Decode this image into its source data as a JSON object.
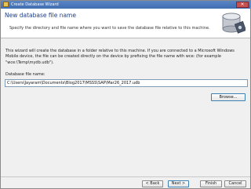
{
  "window": {
    "title": "Create Database Wizard",
    "close_label": "×"
  },
  "header": {
    "title": "New database file name",
    "subtitle": "Specify the directory and file name where you want to save the database file relative to this machine."
  },
  "body": {
    "description": "This wizard will create the database in a folder relative to this machine. If you are connected to a Microsoft Windows Mobile device, the file can be created directly on the device by prefixing the file name with wce: (for example \"wce:\\Temp\\mydb.udb\").",
    "field_label": "Database file name:",
    "field_value": "C:\\Users\\Jayaram\\Documents\\Blog2017\\MSSS\\SAP\\Mar26_2017.udb",
    "browse_label": "Browse..."
  },
  "buttons": {
    "back": "< Back",
    "next": "Next >",
    "finish": "Finish",
    "cancel": "Cancel"
  },
  "icons": {
    "header_icon": "database-disk-icon",
    "title_icon": "wizard-icon"
  }
}
